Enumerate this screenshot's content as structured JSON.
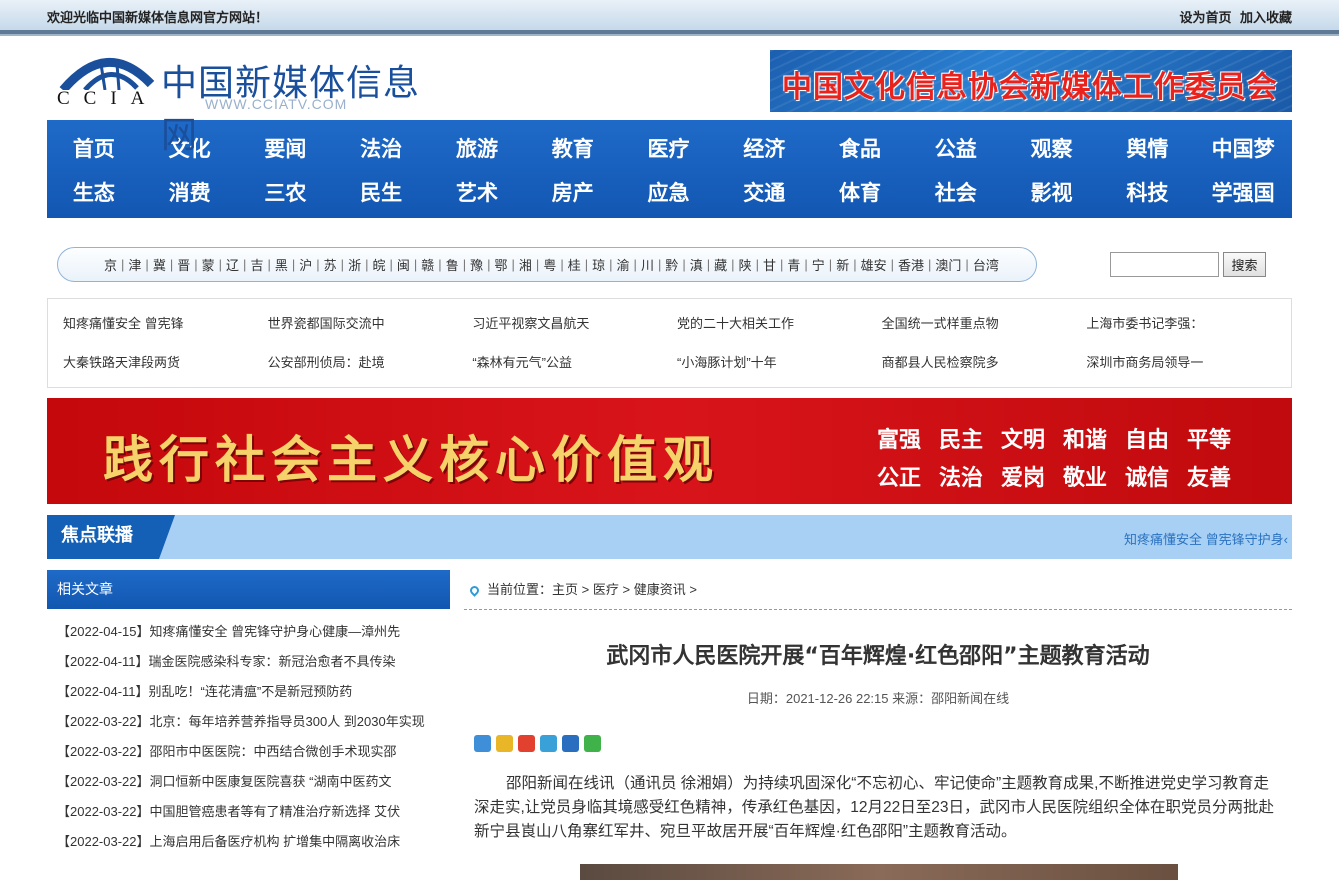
{
  "topbar": {
    "welcome": "欢迎光临中国新媒体信息网官方网站！",
    "set_home": "设为首页",
    "add_fav": "加入收藏"
  },
  "logo": {
    "letters": "CCIA",
    "name": "中国新媒体信息网",
    "url": "WWW.CCIATV.COM"
  },
  "banner_top": {
    "text": "中国文化信息协会新媒体工作委员会"
  },
  "nav": {
    "items": [
      "首页",
      "文化",
      "要闻",
      "法治",
      "旅游",
      "教育",
      "医疗",
      "经济",
      "食品",
      "公益",
      "观察",
      "舆情",
      "中国梦",
      "生态",
      "消费",
      "三农",
      "民生",
      "艺术",
      "房产",
      "应急",
      "交通",
      "体育",
      "社会",
      "影视",
      "科技",
      "学强国"
    ]
  },
  "regions": [
    "京",
    "津",
    "冀",
    "晋",
    "蒙",
    "辽",
    "吉",
    "黑",
    "沪",
    "苏",
    "浙",
    "皖",
    "闽",
    "赣",
    "鲁",
    "豫",
    "鄂",
    "湘",
    "粤",
    "桂",
    "琼",
    "渝",
    "川",
    "黔",
    "滇",
    "藏",
    "陕",
    "甘",
    "青",
    "宁",
    "新",
    "雄安",
    "香港",
    "澳门",
    "台湾"
  ],
  "search": {
    "button": "搜索",
    "value": ""
  },
  "hotnews": [
    "知疼痛懂安全 曾宪锋",
    "世界瓷都国际交流中",
    "习近平视察文昌航天",
    "党的二十大相关工作",
    "全国统一式样重点物",
    "上海市委书记李强：",
    "大秦铁路天津段两货",
    "公安部刑侦局：赴境",
    "“森林有元气”公益",
    "“小海豚计划”十年",
    "商都县人民检察院多",
    "深圳市商务局领导一"
  ],
  "red_banner": {
    "slogan": "践行社会主义核心价值观",
    "values": [
      "富强",
      "民主",
      "文明",
      "和谐",
      "自由",
      "平等",
      "公正",
      "法治",
      "爱岗",
      "敬业",
      "诚信",
      "友善"
    ]
  },
  "focus": {
    "label": "焦点联播",
    "ticker": "知疼痛懂安全 曾宪锋守护身‹"
  },
  "sidebar": {
    "title": "相关文章",
    "items": [
      "【2022-04-15】知疼痛懂安全 曾宪锋守护身心健康—漳州先",
      "【2022-04-11】瑞金医院感染科专家：新冠治愈者不具传染",
      "【2022-04-11】别乱吃！“连花清瘟”不是新冠预防药",
      "【2022-03-22】北京：每年培养营养指导员300人 到2030年实现",
      "【2022-03-22】邵阳市中医医院：中西结合微创手术现实邵",
      "【2022-03-22】洞口恒新中医康复医院喜获 “湖南中医药文",
      "【2022-03-22】中国胆管癌患者等有了精准治疗新选择 艾伏",
      "【2022-03-22】上海启用后备医疗机构 扩增集中隔离收治床"
    ]
  },
  "article": {
    "crumb_prefix": "当前位置：",
    "crumb_home": "主页",
    "crumb_cat": "医疗",
    "crumb_sub": "健康资讯",
    "sep": " > ",
    "title": "武冈市人民医院开展“百年辉煌·红色邵阳”主题教育活动",
    "meta": "日期：2021-12-26 22:15 来源：邵阳新闻在线",
    "body": "邵阳新闻在线讯（通讯员 徐湘娟）为持续巩固深化“不忘初心、牢记使命”主题教育成果,不断推进党史学习教育走深走实,让党员身临其境感受红色精神，传承红色基因，12月22日至23日，武冈市人民医院组织全体在职党员分两批赴新宁县崀山八角寨红军井、宛旦平故居开展“百年辉煌·红色邵阳”主题教育活动。"
  },
  "share_icons": [
    "plus-share-icon",
    "qzone-icon",
    "weibo-icon",
    "tencent-icon",
    "renren-icon",
    "wechat-icon"
  ],
  "colors": {
    "nav_blue": "#1a62be",
    "banner_red": "#c80a0d",
    "focus_blue": "#a8d0f5"
  }
}
